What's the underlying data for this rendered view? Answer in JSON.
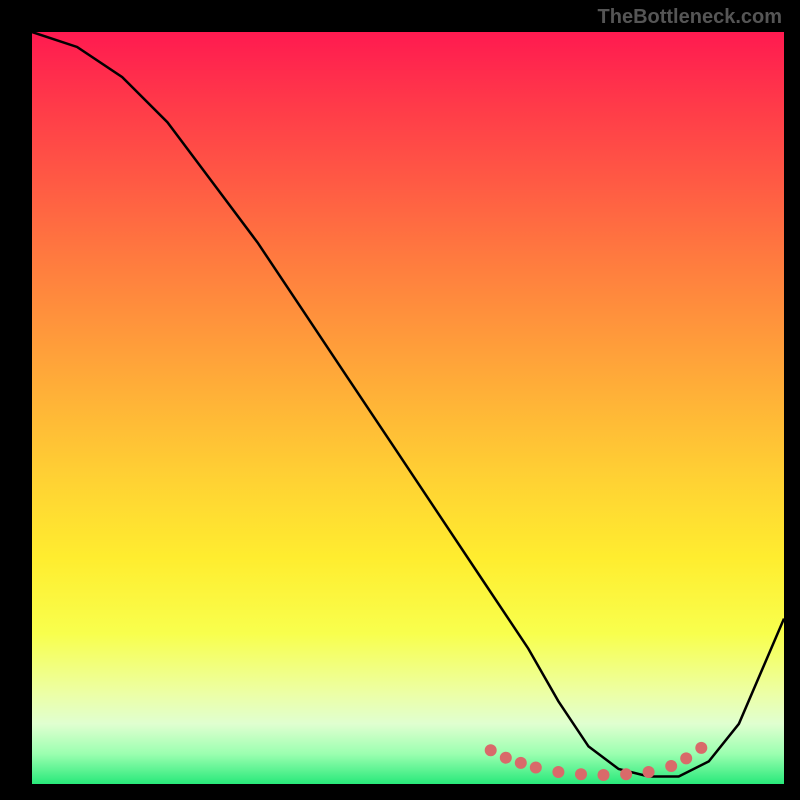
{
  "watermark": "TheBottleneck.com",
  "chart_data": {
    "type": "line",
    "title": "",
    "xlabel": "",
    "ylabel": "",
    "xlim": [
      0,
      100
    ],
    "ylim": [
      0,
      100
    ],
    "x": [
      0,
      6,
      12,
      18,
      24,
      30,
      36,
      42,
      48,
      54,
      60,
      66,
      70,
      74,
      78,
      82,
      86,
      90,
      94,
      100
    ],
    "values": [
      100,
      98,
      94,
      88,
      80,
      72,
      63,
      54,
      45,
      36,
      27,
      18,
      11,
      5,
      2,
      1,
      1,
      3,
      8,
      22
    ],
    "marker_points_x": [
      61,
      63,
      65,
      67,
      70,
      73,
      76,
      79,
      82,
      85,
      87,
      89
    ],
    "marker_points_y": [
      4.5,
      3.5,
      2.8,
      2.2,
      1.6,
      1.3,
      1.2,
      1.3,
      1.6,
      2.4,
      3.4,
      4.8
    ],
    "line_color": "#000000",
    "marker_color": "#d96a6a",
    "background": "gradient_red_to_green"
  }
}
